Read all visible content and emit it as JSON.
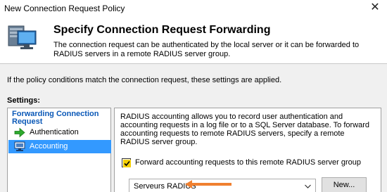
{
  "window": {
    "title": "New Connection Request Policy",
    "close_label": "✕"
  },
  "header": {
    "title": "Specify Connection Request Forwarding",
    "description": "The connection request can be authenticated by the local server or it can be forwarded to RADIUS servers in a remote RADIUS server group."
  },
  "info_text": "If the policy conditions match the connection request, these settings are applied.",
  "settings_label": "Settings:",
  "nav": {
    "header": "Forwarding Connection Request",
    "items": [
      {
        "label": "Authentication",
        "icon": "green-arrow-icon"
      },
      {
        "label": "Accounting",
        "icon": "monitor-icon",
        "selected": true
      }
    ]
  },
  "accounting": {
    "description": "RADIUS accounting allows you to record user authentication and accounting requests in a log file or to a SQL Server database. To forward accounting requests to remote RADIUS servers, specify a remote RADIUS server group.",
    "checkbox_label": "Forward accounting requests to this remote RADIUS server group",
    "checkbox_checked": true,
    "server_group_value": "Serveurs RADIUS",
    "new_button_label": "New..."
  },
  "colors": {
    "accent": "#3399ff",
    "nav_header": "#0a58b7",
    "annotation_arrow": "#f08030",
    "checkbox_fill": "#f5d000"
  }
}
